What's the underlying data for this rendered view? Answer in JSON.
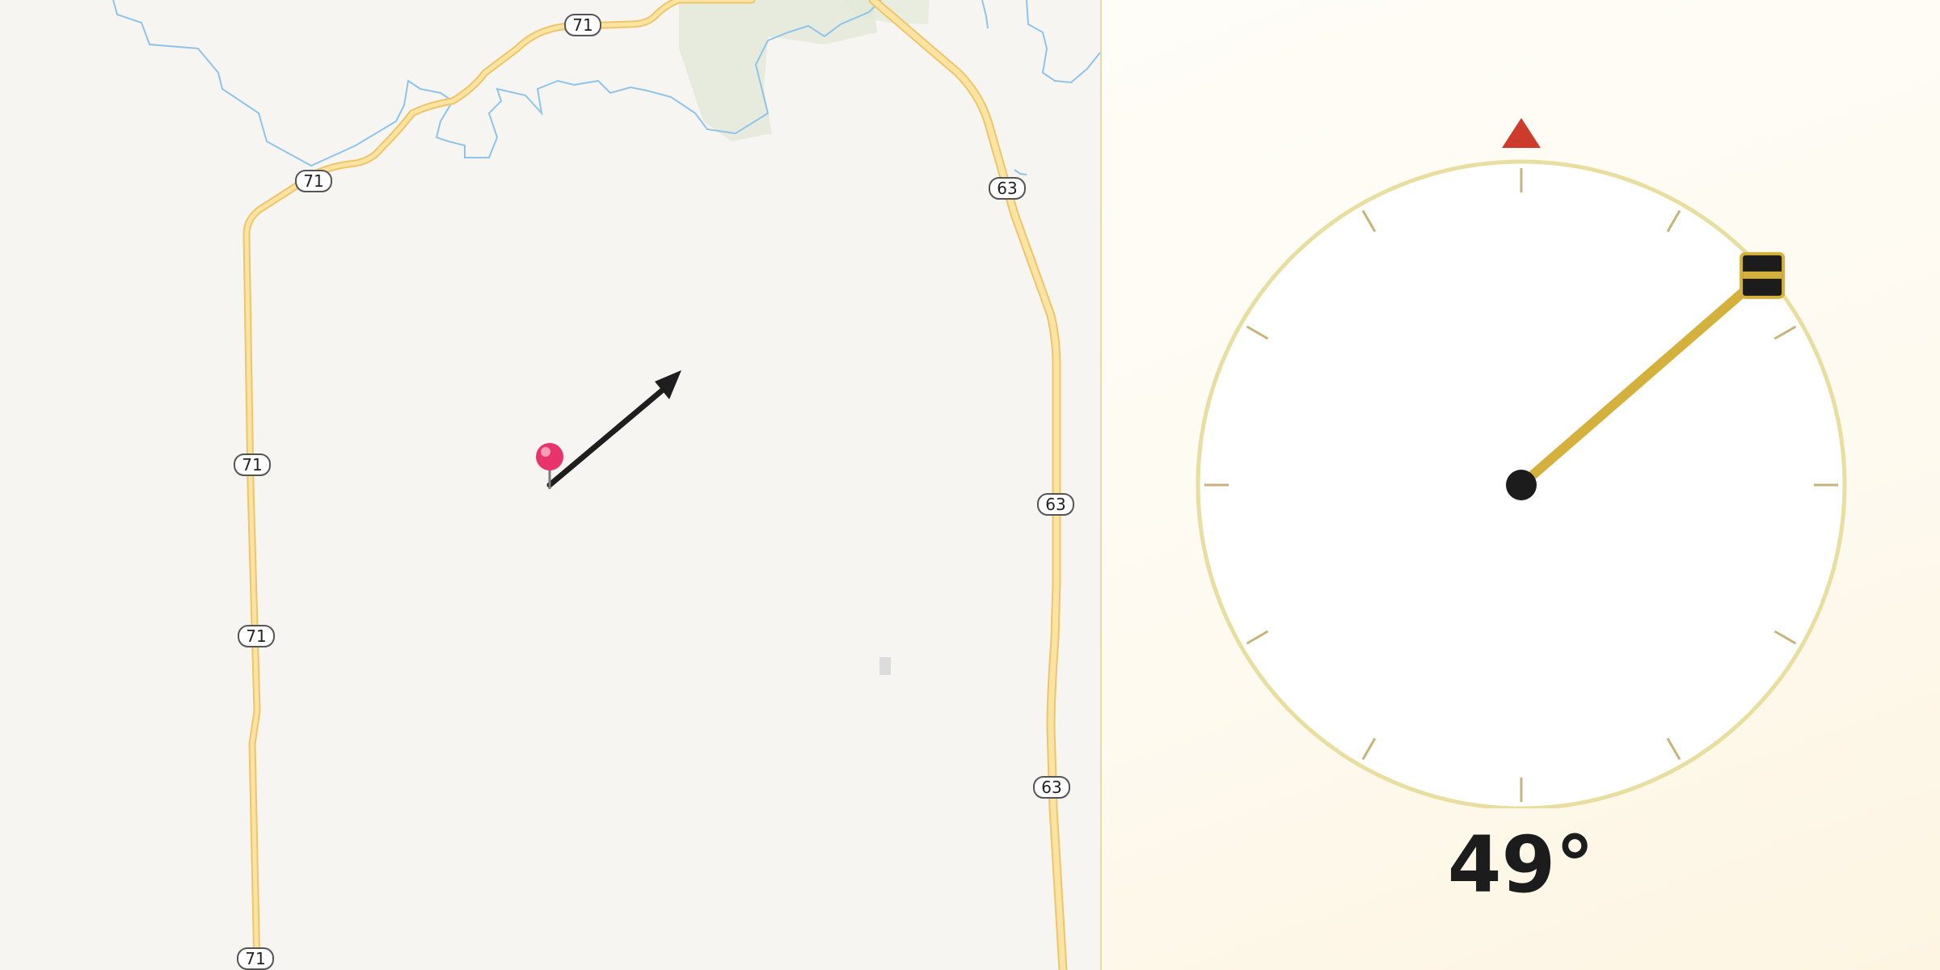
{
  "map": {
    "route_shields": {
      "r71_a": "71",
      "r71_b": "71",
      "r71_c": "71",
      "r71_d": "71",
      "r71_e": "71",
      "r63_a": "63",
      "r63_b": "63",
      "r63_c": "63"
    },
    "colors": {
      "background": "#f7f5f2",
      "road": "#f9d98a",
      "road_edge": "#eec56a",
      "water": "#8fc4ea",
      "park": "#dfe8d6",
      "pin": "#e8336d",
      "arrow": "#1e1e1e"
    }
  },
  "compass": {
    "heading_degrees": 49,
    "heading_label": "49°",
    "colors": {
      "ring": "#e7dea0",
      "tick": "#c6b47a",
      "needle": "#d4b03c",
      "north_marker": "#cc3b2b",
      "hub": "#1c1c1c"
    }
  }
}
